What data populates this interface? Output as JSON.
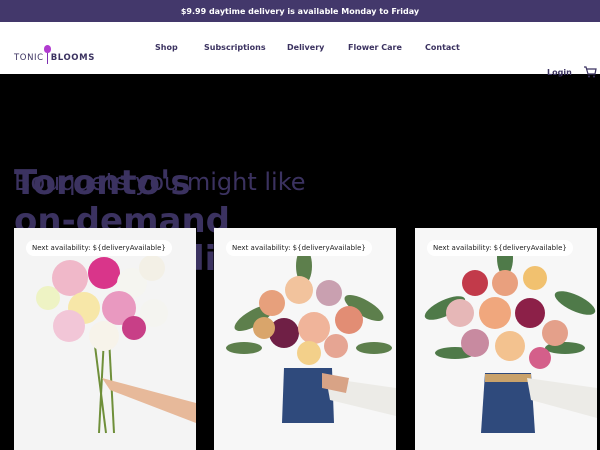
{
  "promo_bar": {
    "text": "$9.99 daytime delivery is available Monday to Friday"
  },
  "header": {
    "logo": {
      "left": "TONIC",
      "right": "BLOOMS"
    },
    "nav": [
      {
        "label": "Shop"
      },
      {
        "label": "Subscriptions"
      },
      {
        "label": "Delivery"
      },
      {
        "label": "Flower Care"
      },
      {
        "label": "Contact"
      }
    ],
    "login_label": "Login",
    "cart_icon": "cart-icon"
  },
  "hero": {
    "title": "Toronto's\non-demand\nflower delivery"
  },
  "section": {
    "title": "Bouquets you might like"
  },
  "cards": [
    {
      "badge": "Next availability: ${deliveryAvailable}",
      "image": "pink-white-dahlia-bouquet"
    },
    {
      "badge": "Next availability: ${deliveryAvailable}",
      "image": "peach-rose-denim-wrap-bouquet"
    },
    {
      "badge": "Next availability: ${deliveryAvailable}",
      "image": "pink-rose-denim-wrap-bouquet"
    }
  ],
  "colors": {
    "brand": "#43386b",
    "text": "#3b3260",
    "accent": "#b13bd0"
  }
}
